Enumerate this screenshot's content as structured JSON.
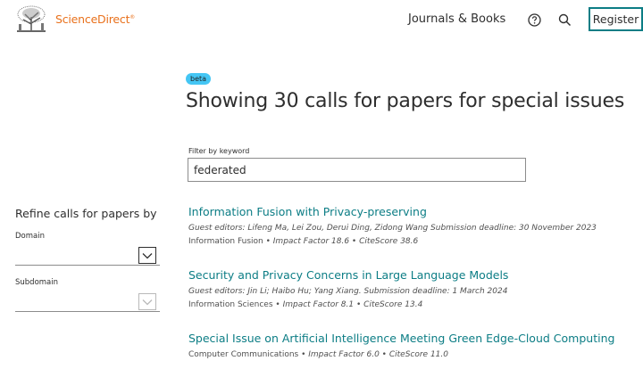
{
  "header": {
    "brand": "ScienceDirect",
    "brand_mark": "®",
    "nav_journals": "Journals & Books",
    "register_label": "Register",
    "icons": [
      "elsevier-tree-logo",
      "help-icon",
      "search-icon"
    ],
    "accent": "#0c7d85",
    "brand_color": "#e9711c"
  },
  "main": {
    "badge": "beta",
    "title": "Showing 30 calls for papers for special issues",
    "filter": {
      "label": "Filter by keyword",
      "value": "federated"
    }
  },
  "sidebar": {
    "title": "Refine calls for papers by",
    "domain_label": "Domain",
    "subdomain_label": "Subdomain"
  },
  "results": [
    {
      "title": "Information Fusion with Privacy-preserving",
      "editors": "Guest editors: Lifeng Ma, Lei Zou, Derui Ding, Zidong Wang Submission deadline: 30 November 2023",
      "journal": "Information Fusion",
      "impact": "Impact Factor 18.6",
      "citescore": "CiteScore 38.6"
    },
    {
      "title": "Security and Privacy Concerns in Large Language Models",
      "editors": "Guest editors: Jin Li; Haibo Hu; Yang Xiang. Submission deadline: 1 March 2024",
      "journal": "Information Sciences",
      "impact": "Impact Factor 8.1",
      "citescore": "CiteScore 13.4"
    },
    {
      "title": "Special Issue on Artificial Intelligence Meeting Green Edge-Cloud Computing",
      "editors": "",
      "journal": "Computer Communications",
      "impact": "Impact Factor 6.0",
      "citescore": "CiteScore 11.0"
    }
  ]
}
